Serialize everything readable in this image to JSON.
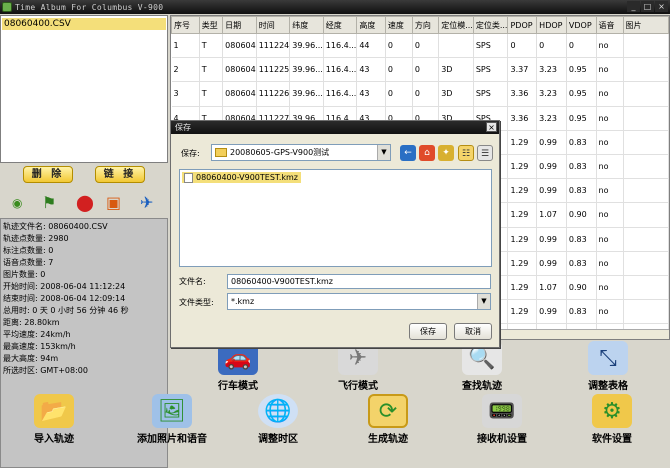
{
  "window": {
    "title": "Time Album For Columbus V-900"
  },
  "file_list": {
    "items": [
      "08060400.CSV"
    ]
  },
  "buttons": {
    "delete": "删 除",
    "link": "链 接"
  },
  "info": {
    "rows": [
      "轨迹文件名: 08060400.CSV",
      "轨迹点数量: 2980",
      "标注点数量: 0",
      "语音点数量: 7",
      "图片数量: 0",
      "开始时间: 2008-06-04 11:12:24",
      "结束时间: 2008-06-04 12:09:14",
      "总用时: 0 天 0 小时 56 分钟 46 秒",
      "距离: 28.80km",
      "平均速度: 24km/h",
      "最高速度: 153km/h",
      "最大高度: 94m",
      "所选时区: GMT+08:00"
    ]
  },
  "table": {
    "headers": [
      "序号",
      "类型",
      "日期",
      "时间",
      "纬度",
      "经度",
      "高度",
      "速度",
      "方向",
      "定位模...",
      "定位类...",
      "PDOP",
      "HDOP",
      "VDOP",
      "语音",
      "图片"
    ],
    "rows": [
      [
        "1",
        "T",
        "080604",
        "111224",
        "39.96...",
        "116.4...",
        "44",
        "0",
        "0",
        "",
        "SPS",
        "0",
        "0",
        "0",
        "no",
        ""
      ],
      [
        "2",
        "T",
        "080604",
        "111225",
        "39.96...",
        "116.4...",
        "43",
        "0",
        "0",
        "3D",
        "SPS",
        "3.37",
        "3.23",
        "0.95",
        "no",
        ""
      ],
      [
        "3",
        "T",
        "080604",
        "111226",
        "39.96...",
        "116.4...",
        "43",
        "0",
        "0",
        "3D",
        "SPS",
        "3.36",
        "3.23",
        "0.95",
        "no",
        ""
      ],
      [
        "4",
        "T",
        "080604",
        "111227",
        "39.96...",
        "116.4...",
        "43",
        "0",
        "0",
        "3D",
        "SPS",
        "3.36",
        "3.23",
        "0.95",
        "no",
        ""
      ],
      [
        "5",
        "T",
        "080604",
        "111228",
        "",
        "",
        "",
        "",
        "",
        "",
        "",
        "1.29",
        "0.99",
        "0.83",
        "no",
        ""
      ],
      [
        "",
        "",
        "",
        "",
        "",
        "",
        "",
        "",
        "",
        "",
        "",
        "1.29",
        "0.99",
        "0.83",
        "no",
        ""
      ],
      [
        "",
        "",
        "",
        "",
        "",
        "",
        "",
        "",
        "",
        "",
        "",
        "1.29",
        "0.99",
        "0.83",
        "no",
        ""
      ],
      [
        "",
        "",
        "",
        "",
        "",
        "",
        "",
        "",
        "",
        "",
        "",
        "1.29",
        "1.07",
        "0.90",
        "no",
        ""
      ],
      [
        "",
        "",
        "",
        "",
        "",
        "",
        "",
        "",
        "",
        "",
        "",
        "1.29",
        "0.99",
        "0.83",
        "no",
        ""
      ],
      [
        "",
        "",
        "",
        "",
        "",
        "",
        "",
        "",
        "",
        "",
        "",
        "1.29",
        "0.99",
        "0.83",
        "no",
        ""
      ],
      [
        "",
        "",
        "",
        "",
        "",
        "",
        "",
        "",
        "",
        "",
        "",
        "1.29",
        "1.07",
        "0.90",
        "no",
        ""
      ],
      [
        "",
        "",
        "",
        "",
        "",
        "",
        "",
        "",
        "",
        "",
        "",
        "1.29",
        "0.99",
        "0.83",
        "no",
        ""
      ],
      [
        "",
        "",
        "",
        "",
        "",
        "",
        "",
        "",
        "",
        "",
        "",
        "1.29",
        "0.99",
        "0.83",
        "no",
        ""
      ]
    ]
  },
  "toolbar": {
    "drive_mode": "行车模式",
    "fly_mode": "飞行模式",
    "find_track": "查找轨迹",
    "adjust_table": "调整表格"
  },
  "bottom_toolbar": {
    "import_track": "导入轨迹",
    "add_photos_voice": "添加照片和语音",
    "adjust_timezone": "调整时区",
    "generate_track": "生成轨迹",
    "receiver_settings": "接收机设置",
    "software_settings": "软件设置"
  },
  "dialog": {
    "title": "保存",
    "save_in_label": "保存:",
    "save_in_value": "20080605-GPS-V900测试",
    "files": [
      "08060400-V900TEST.kmz"
    ],
    "filename_label": "文件名:",
    "filename_value": "08060400-V900TEST.kmz",
    "filetype_label": "文件类型:",
    "filetype_value": "*.kmz",
    "save_button": "保存",
    "cancel_button": "取消"
  },
  "colors": {
    "selection": "#f4df7a",
    "title_bar": "#1a1a1a",
    "button_yellow": "#f2c833"
  }
}
